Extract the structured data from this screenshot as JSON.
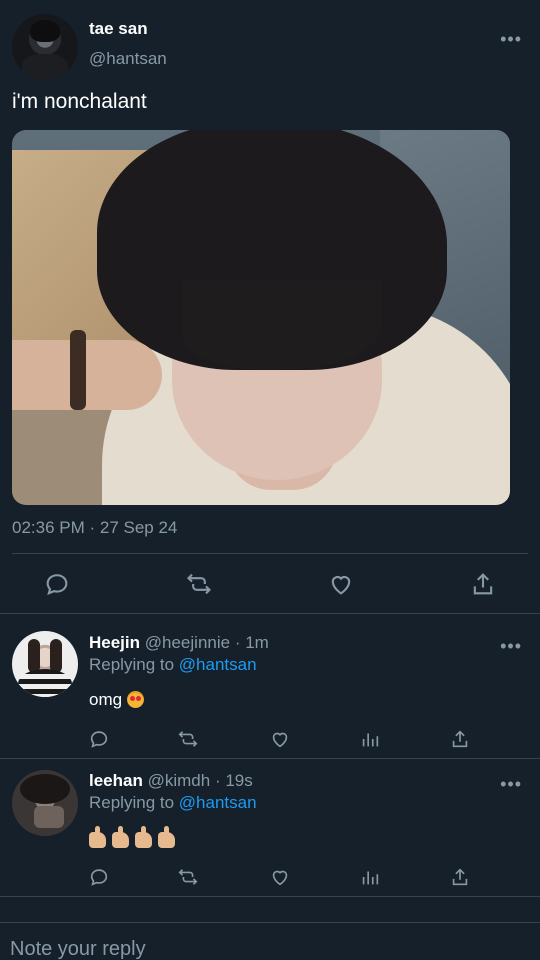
{
  "main_tweet": {
    "name": "tae san",
    "handle": "@hantsan",
    "text": "i'm nonchalant",
    "timestamp": "02:36 PM · 27 Sep 24",
    "more_label": "•••"
  },
  "replies": [
    {
      "name": "Heejin",
      "handle": "@heejinnie",
      "time": "· 1m",
      "replying_prefix": "Replying to",
      "replying_to": "@hantsan",
      "text": "omg",
      "emoji": "heart-eyes"
    },
    {
      "name": "leehan",
      "handle": "@kimdh",
      "time": "· 19s",
      "replying_prefix": "Replying to",
      "replying_to": "@hantsan",
      "text": "",
      "emoji": "thumbs-up x4"
    }
  ],
  "reply_input": {
    "placeholder": "Note your reply"
  },
  "colors": {
    "background": "#15202b",
    "secondary_text": "#8899a6",
    "link": "#1d9bf0",
    "divider": "#38444d"
  },
  "icons": [
    "reply-icon",
    "retweet-icon",
    "like-icon",
    "share-icon",
    "analytics-icon",
    "more-icon"
  ]
}
